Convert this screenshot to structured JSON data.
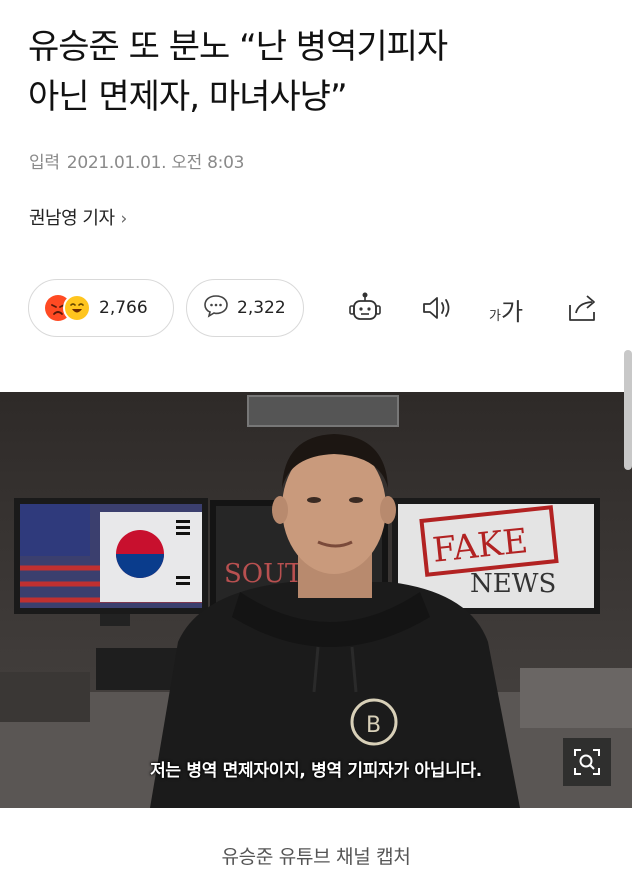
{
  "article": {
    "headline_line1": "유승준 또 분노 “난 병역기피자",
    "headline_line2": "아닌 면제자, 마녀사냥”",
    "published_label": "입력",
    "published_value": "2021.01.01. 오전 8:03",
    "reporter": "권남영 기자",
    "reporter_chevron": "›"
  },
  "toolbar": {
    "reaction_count": "2,766",
    "comment_count": "2,322",
    "font_size_small": "가",
    "font_size_large": "가",
    "icons": [
      "robot-summary-icon",
      "speaker-icon",
      "font-size-icon",
      "share-icon"
    ]
  },
  "photo": {
    "subtitle": "저는 병역 면제자이지, 병역 기피자가 아닙니다.",
    "monitor_right_text1": "FAKE",
    "monitor_right_text2": "NEWS",
    "monitor_mid_text": "SOUT",
    "caption": "유승준 유튜브 채널 캡처"
  },
  "colors": {
    "accent_angry": "#ff4a23",
    "accent_laugh": "#ffc51e",
    "meta_gray": "#8a8a8a"
  }
}
